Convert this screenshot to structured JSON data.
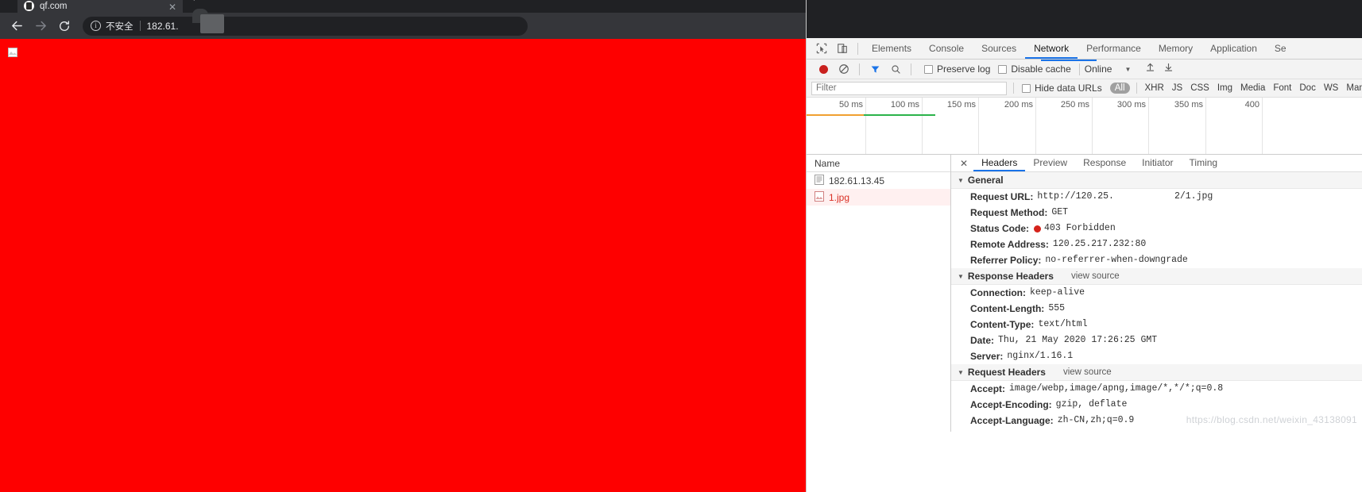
{
  "browser": {
    "tab": {
      "title": "qf.com",
      "close_label": "✕",
      "favicon": "page-favicon"
    },
    "new_tab_label": "+",
    "nav": {
      "back": "back-arrow",
      "forward": "forward-arrow",
      "reload": "reload-arrow"
    },
    "omnibox": {
      "security_label": "不安全",
      "info_icon": "i",
      "url": "182.61."
    }
  },
  "page": {
    "background_color": "#fe0000",
    "broken_image_alt": "broken-image"
  },
  "devtools": {
    "panel_tabs": [
      {
        "label": "Elements",
        "active": false
      },
      {
        "label": "Console",
        "active": false
      },
      {
        "label": "Sources",
        "active": false
      },
      {
        "label": "Network",
        "active": true
      },
      {
        "label": "Performance",
        "active": false
      },
      {
        "label": "Memory",
        "active": false
      },
      {
        "label": "Application",
        "active": false
      },
      {
        "label": "Se",
        "active": false
      }
    ],
    "network_toolbar": {
      "record_tooltip": "record-button",
      "clear_tooltip": "clear-button",
      "filter_tooltip": "filter-button",
      "search_tooltip": "search-button",
      "preserve_log": "Preserve log",
      "disable_cache": "Disable cache",
      "throttle": "Online",
      "caret": "▼",
      "import_tooltip": "import-har",
      "export_tooltip": "export-har"
    },
    "filter_bar": {
      "placeholder": "Filter",
      "hide_data_urls": "Hide data URLs",
      "types": [
        "All",
        "XHR",
        "JS",
        "CSS",
        "Img",
        "Media",
        "Font",
        "Doc",
        "WS",
        "Manife"
      ]
    },
    "timeline": {
      "ticks": [
        "50 ms",
        "100 ms",
        "150 ms",
        "200 ms",
        "250 ms",
        "300 ms",
        "350 ms",
        "400"
      ]
    },
    "requests": {
      "column_header": "Name",
      "rows": [
        {
          "name": "182.61.13.45",
          "icon": "document-icon",
          "error": false
        },
        {
          "name": "1.jpg",
          "icon": "image-icon",
          "error": true
        }
      ]
    },
    "detail": {
      "close_label": "✕",
      "tabs": [
        {
          "label": "Headers",
          "active": true
        },
        {
          "label": "Preview",
          "active": false
        },
        {
          "label": "Response",
          "active": false
        },
        {
          "label": "Initiator",
          "active": false
        },
        {
          "label": "Timing",
          "active": false
        }
      ],
      "sections": [
        {
          "title": "General",
          "view_source": "",
          "rows": [
            {
              "key": "Request URL:",
              "value_prefix": "http://120.25.",
              "redacted": true,
              "value_suffix": "2/1.jpg"
            },
            {
              "key": "Request Method:",
              "value": "GET"
            },
            {
              "key": "Status Code:",
              "value": "403 Forbidden",
              "status": true
            },
            {
              "key": "Remote Address:",
              "value": "120.25.217.232:80"
            },
            {
              "key": "Referrer Policy:",
              "value": "no-referrer-when-downgrade"
            }
          ]
        },
        {
          "title": "Response Headers",
          "view_source": "view source",
          "rows": [
            {
              "key": "Connection:",
              "value": "keep-alive"
            },
            {
              "key": "Content-Length:",
              "value": "555"
            },
            {
              "key": "Content-Type:",
              "value": "text/html"
            },
            {
              "key": "Date:",
              "value": "Thu, 21 May 2020 17:26:25 GMT"
            },
            {
              "key": "Server:",
              "value": "nginx/1.16.1"
            }
          ]
        },
        {
          "title": "Request Headers",
          "view_source": "view source",
          "rows": [
            {
              "key": "Accept:",
              "value": "image/webp,image/apng,image/*,*/*;q=0.8"
            },
            {
              "key": "Accept-Encoding:",
              "value": "gzip, deflate"
            },
            {
              "key": "Accept-Language:",
              "value": "zh-CN,zh;q=0.9"
            }
          ]
        }
      ]
    },
    "watermark": "https://blog.csdn.net/weixin_43138091"
  },
  "colors": {
    "accent": "#1a73e8",
    "error": "#d93025",
    "page_bg": "#fe0000"
  }
}
